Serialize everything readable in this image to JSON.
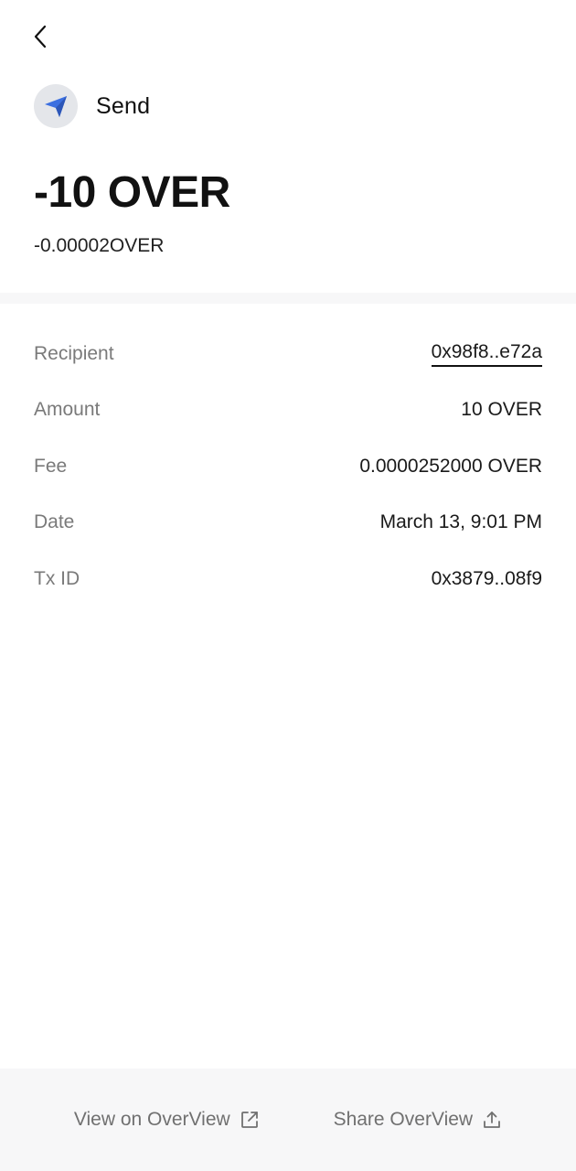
{
  "header": {
    "back_icon": "chevron-left-icon"
  },
  "transaction": {
    "type_label": "Send",
    "type_icon": "paper-plane-icon",
    "amount": "-10 OVER",
    "sub_amount": "-0.00002OVER"
  },
  "details": {
    "recipient": {
      "label": "Recipient",
      "value": "0x98f8..e72a"
    },
    "amount": {
      "label": "Amount",
      "value": "10 OVER"
    },
    "fee": {
      "label": "Fee",
      "value": "0.0000252000 OVER"
    },
    "date": {
      "label": "Date",
      "value": "March 13, 9:01 PM"
    },
    "txid": {
      "label": "Tx ID",
      "value": "0x3879..08f9"
    }
  },
  "footer": {
    "view_label": "View on OverView",
    "view_icon": "external-link-icon",
    "share_label": "Share OverView",
    "share_icon": "share-icon"
  },
  "colors": {
    "accent_icon": "#3b6fe0",
    "avatar_bg": "#e4e6ea",
    "label_gray": "#7a7a7a",
    "footer_bg": "#f7f7f8"
  }
}
